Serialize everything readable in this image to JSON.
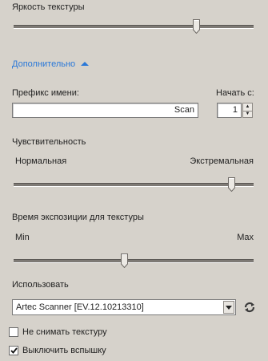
{
  "texture_brightness": {
    "label": "Яркость текстуры",
    "value_fraction": 0.77
  },
  "advanced": {
    "label": "Дополнительно",
    "icon": "chevron-up-icon",
    "accent_color": "#2a78d8"
  },
  "name_prefix": {
    "label": "Префикс имени:",
    "value": "Scan"
  },
  "start_from": {
    "label": "Начать с:",
    "value": "1"
  },
  "sensitivity": {
    "label": "Чувствительность",
    "min_label": "Нормальная",
    "max_label": "Экстремальная",
    "value_fraction": 0.92
  },
  "texture_exposure": {
    "label": "Время экспозиции для текстуры",
    "min_label": "Min",
    "max_label": "Max",
    "value_fraction": 0.46
  },
  "use": {
    "label": "Использовать",
    "selected": "Artec Scanner [EV.12.10213310]",
    "refresh_icon": "refresh-icon"
  },
  "options": {
    "no_texture": {
      "label": "Не снимать текстуру",
      "checked": false
    },
    "disable_flash": {
      "label": "Выключить вспышку",
      "checked": true
    }
  }
}
